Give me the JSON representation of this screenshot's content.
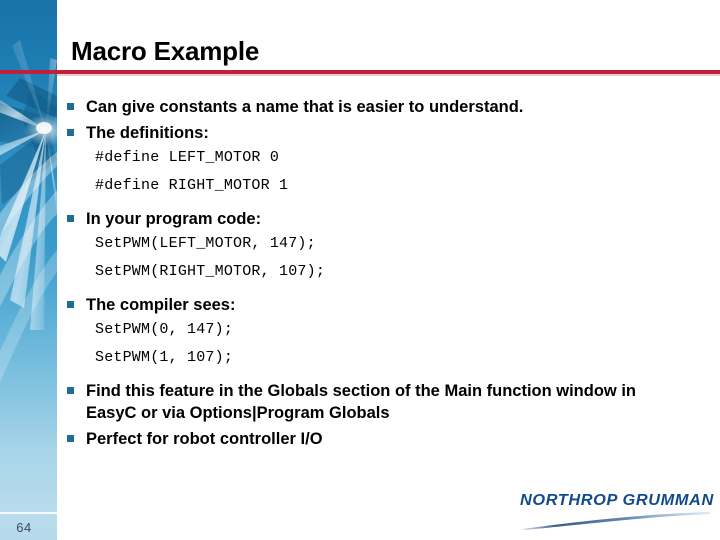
{
  "slide": {
    "title": "Macro Example",
    "page_number": "64",
    "accent_rule_color": "#c0203c",
    "bullet_color": "#1f6e91",
    "sidebar_color_top": "#1873a9",
    "sidebar_color_bottom": "#b9dced"
  },
  "content": {
    "blocks": [
      {
        "kind": "bullet",
        "text": "Can give constants a name that is easier to understand."
      },
      {
        "kind": "bullet",
        "text": "The definitions:"
      },
      {
        "kind": "code",
        "text": "#define LEFT_MOTOR 0"
      },
      {
        "kind": "code",
        "text": "#define RIGHT_MOTOR 1"
      },
      {
        "kind": "bullet",
        "text": "In your program code:"
      },
      {
        "kind": "code",
        "text": "SetPWM(LEFT_MOTOR, 147);"
      },
      {
        "kind": "code",
        "text": "SetPWM(RIGHT_MOTOR, 107);"
      },
      {
        "kind": "bullet",
        "text": "The compiler sees:"
      },
      {
        "kind": "code",
        "text": "SetPWM(0, 147);"
      },
      {
        "kind": "code",
        "text": "SetPWM(1, 107);"
      },
      {
        "kind": "bullet",
        "text": "Find this feature in the Globals section of the Main function window in EasyC or via Options|Program Globals"
      },
      {
        "kind": "bullet",
        "text": "Perfect for robot controller I/O"
      }
    ]
  },
  "logo": {
    "text": "NORTHROP GRUMMAN",
    "color": "#134a8e"
  }
}
